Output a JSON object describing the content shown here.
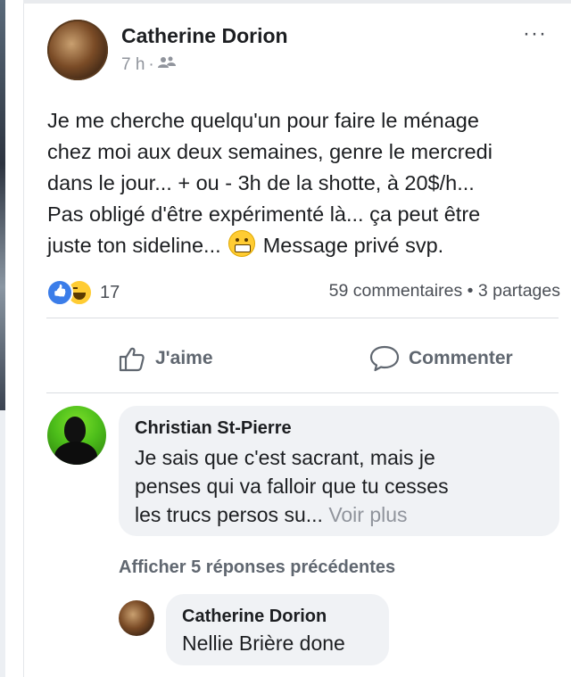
{
  "post": {
    "author": "Catherine Dorion",
    "time": "7 h",
    "separator": "·",
    "more_label": "···",
    "text_lines": [
      "Je me cherche quelqu'un pour faire le ménage",
      "chez moi aux deux semaines, genre le mercredi",
      "dans le jour... + ou - 3h de la shotte, à 20$/h...",
      "Pas obligé d'être expérimenté là... ça peut être"
    ],
    "text_last_before_emoji": "juste ton sideline...",
    "text_last_after_emoji": "Message privé svp.",
    "reaction_icons": [
      "like-icon",
      "haha-icon"
    ],
    "reaction_count": "17",
    "stats": "59 commentaires • 3 partages",
    "actions": {
      "like_label": "J'aime",
      "comment_label": "Commenter"
    }
  },
  "comment": {
    "author": "Christian St-Pierre",
    "lines": [
      "Je sais que c'est sacrant, mais je",
      "penses qui va falloir que tu cesses"
    ],
    "last_line": "les trucs persos su...",
    "see_more": "Voir plus"
  },
  "previous_replies": "Afficher 5 réponses précédentes",
  "reply": {
    "author": "Catherine Dorion",
    "text": "Nellie Brière done"
  },
  "colors": {
    "text": "#1c1e21",
    "secondary": "#90949c",
    "action": "#606770",
    "bubble": "#f0f2f5",
    "like_blue": "#3b7de9"
  }
}
